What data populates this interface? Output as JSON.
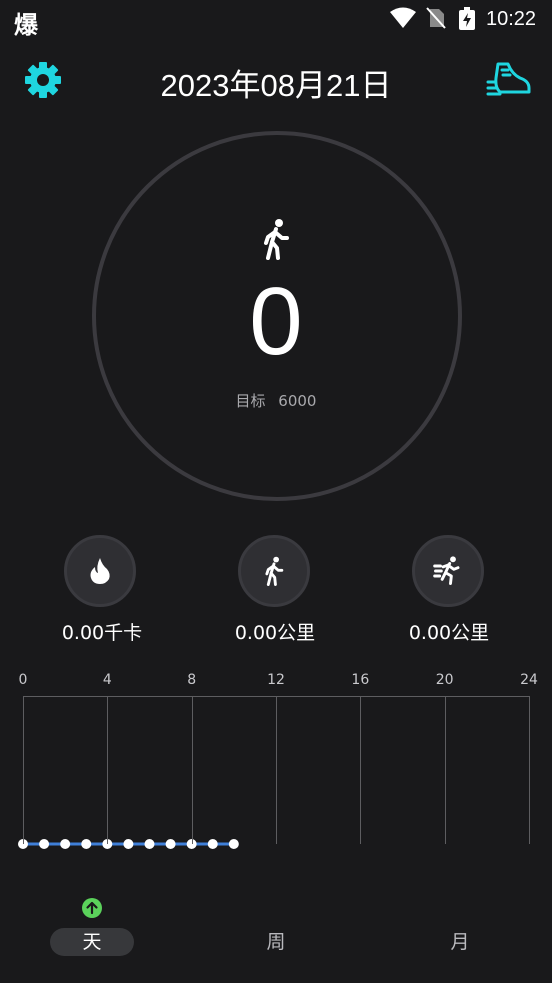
{
  "status_bar": {
    "app_glyph": "爆",
    "time": "10:22",
    "icons": [
      "wifi-icon",
      "no-sim-icon",
      "battery-charging-icon"
    ]
  },
  "header": {
    "date_title": "2023年08月21日",
    "left_icon": "gear-icon",
    "right_icon": "shoe-icon",
    "accent": "#1fd6e0"
  },
  "summary": {
    "steps": "0",
    "goal_label": "目标",
    "goal_value": "6000"
  },
  "stats": [
    {
      "value": "0.00千卡",
      "icon": "flame-icon"
    },
    {
      "value": "0.00公里",
      "icon": "walk-icon"
    },
    {
      "value": "0.00公里",
      "icon": "run-icon"
    }
  ],
  "chart_data": {
    "type": "line",
    "x_ticks": [
      "0",
      "4",
      "8",
      "12",
      "16",
      "20",
      "24"
    ],
    "x": [
      0,
      1,
      2,
      3,
      4,
      5,
      6,
      7,
      8,
      9,
      10
    ],
    "series": [
      {
        "values": [
          0,
          0,
          0,
          0,
          0,
          0,
          0,
          0,
          0,
          0,
          0
        ]
      }
    ],
    "xlim": [
      0,
      24
    ],
    "line_color": "#3f7fd8"
  },
  "tabs": [
    {
      "label": "天",
      "active": true
    },
    {
      "label": "周",
      "active": false
    },
    {
      "label": "月",
      "active": false
    }
  ]
}
